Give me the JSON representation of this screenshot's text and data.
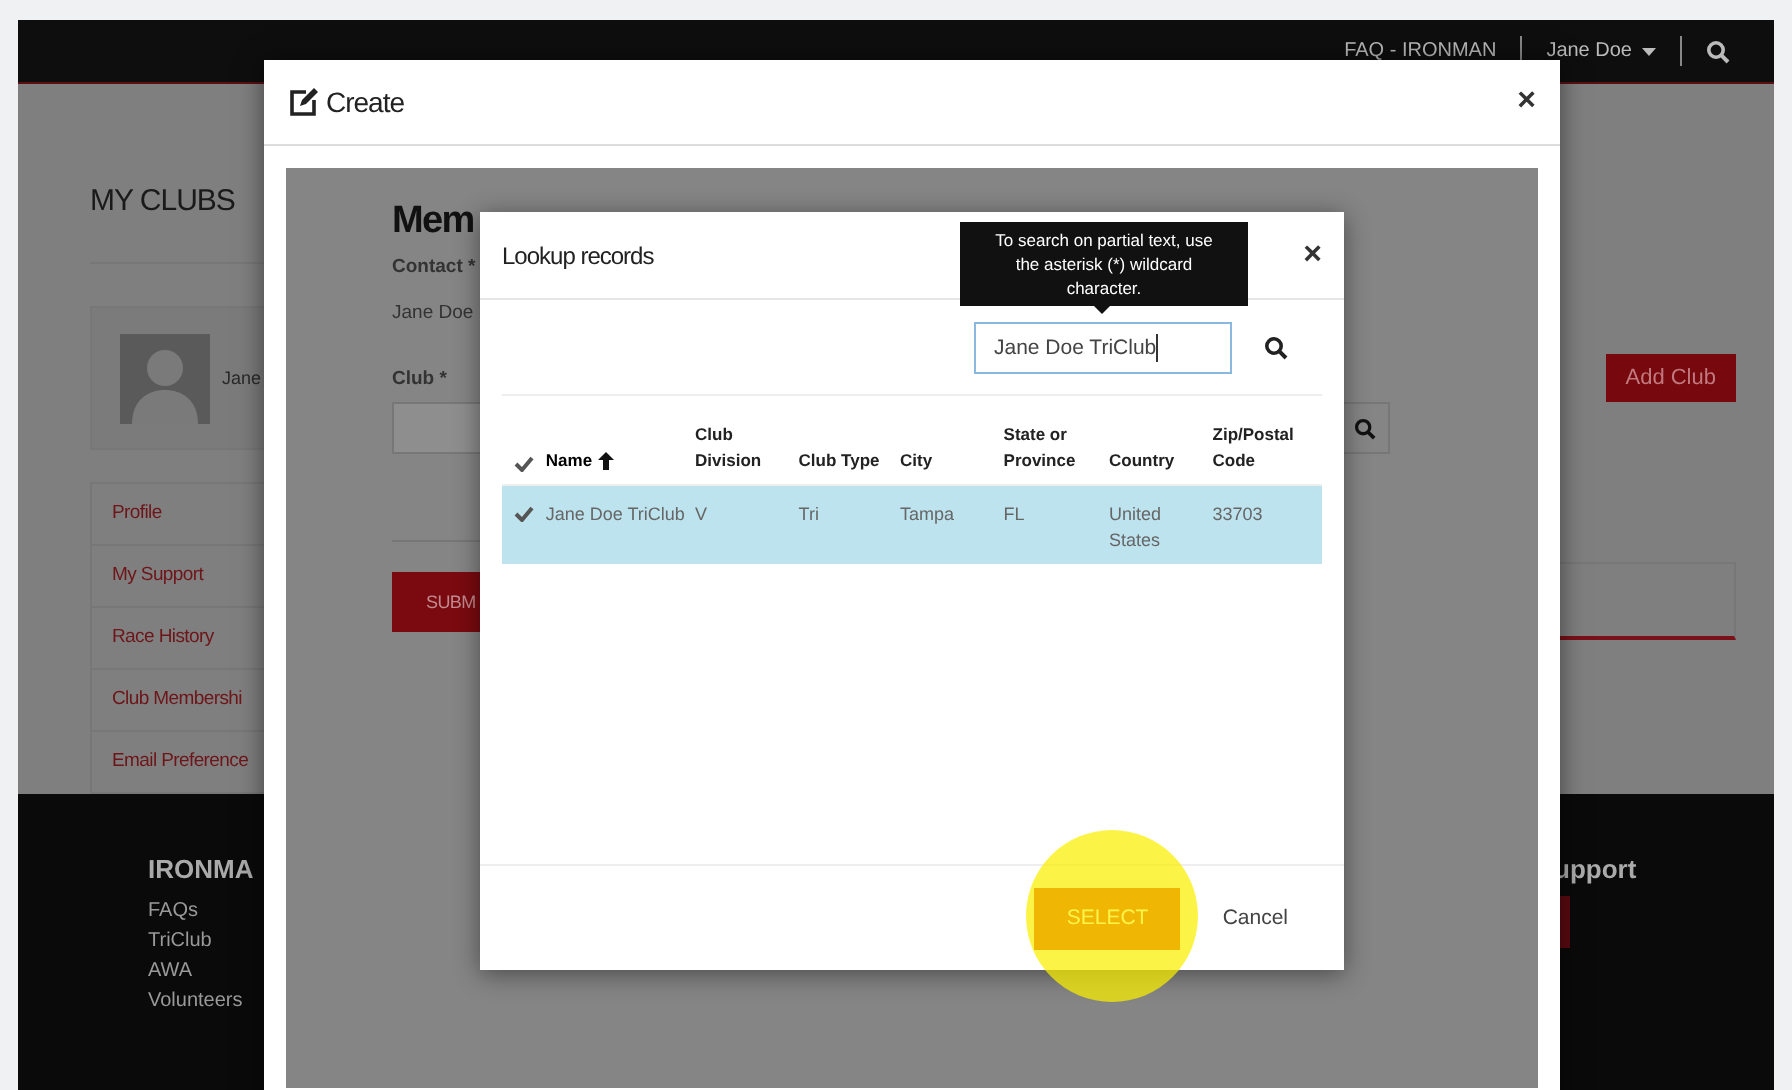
{
  "top_bar": {
    "faq_link": "FAQ - IRONMAN",
    "user_menu": "Jane Doe"
  },
  "page": {
    "title": "MY CLUBS",
    "profile_name": "Jane",
    "nav": [
      {
        "label": "Profile"
      },
      {
        "label": "My Support"
      },
      {
        "label": "Race History"
      },
      {
        "label": "Club Membershi"
      },
      {
        "label": "Email Preference"
      }
    ],
    "add_club_button": "Add Club"
  },
  "footer": {
    "column_1": {
      "heading": "IRONMA",
      "links": [
        "FAQs",
        "TriClub",
        "AWA",
        "Volunteers"
      ]
    },
    "column_2": {
      "heading": "upport"
    }
  },
  "create_dialog": {
    "title": "Create",
    "close_label": "×",
    "form": {
      "heading": "Mem",
      "contact_label": "Contact *",
      "contact_value": "Jane Doe",
      "club_label": "Club *",
      "submit_button": "SUBM"
    }
  },
  "lookup_dialog": {
    "title": "Lookup records",
    "close_label": "×",
    "tooltip": "To search on partial text, use the asterisk (*) wildcard character.",
    "search_value": "Jane Doe TriClub",
    "columns": [
      {
        "label": "Name",
        "sorted": true
      },
      {
        "label": "Club Division",
        "sorted": false
      },
      {
        "label": "Club Type",
        "sorted": false
      },
      {
        "label": "City",
        "sorted": false
      },
      {
        "label": "State or Province",
        "sorted": false
      },
      {
        "label": "Country",
        "sorted": false
      },
      {
        "label": "Zip/Postal Code",
        "sorted": false
      }
    ],
    "rows": [
      {
        "selected": true,
        "cells": [
          "Jane Doe TriClub",
          "V",
          "Tri",
          "Tampa",
          "FL",
          "United States",
          "33703"
        ]
      }
    ],
    "select_button": "SELECT",
    "cancel_button": "Cancel"
  }
}
